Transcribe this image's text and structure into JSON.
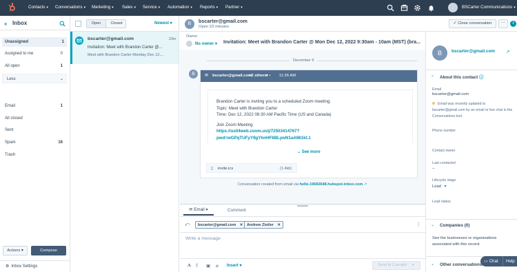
{
  "topnav": {
    "items": [
      "Contacts",
      "Conversations",
      "Marketing",
      "Sales",
      "Service",
      "Automation",
      "Reports",
      "Partner"
    ],
    "account": "BSCarter Communications"
  },
  "sidebar": {
    "title": "Inbox",
    "items": [
      {
        "label": "Unassigned",
        "count": "1"
      },
      {
        "label": "Assigned to me",
        "count": "0"
      },
      {
        "label": "All open",
        "count": "1"
      },
      {
        "label": "Less",
        "count": ""
      },
      {
        "label": "Email",
        "count": "1"
      },
      {
        "label": "All closed",
        "count": ""
      },
      {
        "label": "Sent",
        "count": ""
      },
      {
        "label": "Spam",
        "count": "16"
      },
      {
        "label": "Trash",
        "count": ""
      }
    ],
    "actions_label": "Actions",
    "compose_label": "Compose",
    "settings_label": "Inbox Settings"
  },
  "list": {
    "tab_open": "Open",
    "tab_closed": "Closed",
    "sort": "Newest",
    "items": [
      {
        "sender": "bscarter@gmail.com",
        "time": "23m",
        "subject": "Invitation: Meet with Brandon Carter @...",
        "preview": "Meet with Brandon Carter Monday Dec 12,..."
      }
    ]
  },
  "thread": {
    "avatar": "B",
    "sender": "bscarter@gmail.com",
    "status": "Open 23 minutes",
    "close_label": "Close conversation",
    "owner_label": "Owner",
    "owner_value": "No owner",
    "subject": "Invitation: Meet with Brandon Carter @ Mon Dec 12, 2022 9:30am - 10am (MST) (bra...",
    "date_divider": "December 9",
    "message": {
      "from": "bscarter@gmail.com",
      "others": "+2 others",
      "time": "11:26 AM",
      "lines": [
        "Brandon Carter is inviting you to a scheduled Zoom meeting.",
        "Topic: Meet with Brandon Carter",
        "Time: Dec 12, 2022 08:30 AM Pacific Time (US and Canada)",
        "Join Zoom Meeting"
      ],
      "link1": "https://us04web.zoom.us/j/72503414767?",
      "link2": "pwd=wGPqTUFyY9gYhnHF6BLywN1aA961kt.1",
      "see_more": "See more",
      "attachment_name": "invite.ics",
      "attachment_size": "(1.4kb)"
    },
    "footer_text": "Conversation created from email via",
    "footer_link": "hello-19692648.hubspot-inbox.com"
  },
  "composer": {
    "tab_email": "Email",
    "tab_comment": "Comment",
    "recipients": [
      "bscarter@gmail.com",
      "Andrew Zistler"
    ],
    "placeholder": "Write a message",
    "insert_label": "Insert",
    "send_label": "Send to 2 people"
  },
  "contact": {
    "avatar": "B",
    "email": "bscarter@gmail.com",
    "about_title": "About this contact",
    "email_label": "Email",
    "email_value": "bscarter@gmail.com",
    "notice": "Email was recently updated to bscarter@gmail.com by an email or live chat in the Conversations tool.",
    "phone_label": "Phone number",
    "owner_label": "Contact owner",
    "last_contacted_label": "Last contacted",
    "last_contacted_value": "--",
    "lifecycle_label": "Lifecycle stage",
    "lifecycle_value": "Lead",
    "lead_status_label": "Lead status",
    "companies_title": "Companies (0)",
    "companies_text": "See the businesses or organizations associated with this record.",
    "other_title": "Other conversations",
    "chat_label": "Chat",
    "help_label": "Help"
  }
}
